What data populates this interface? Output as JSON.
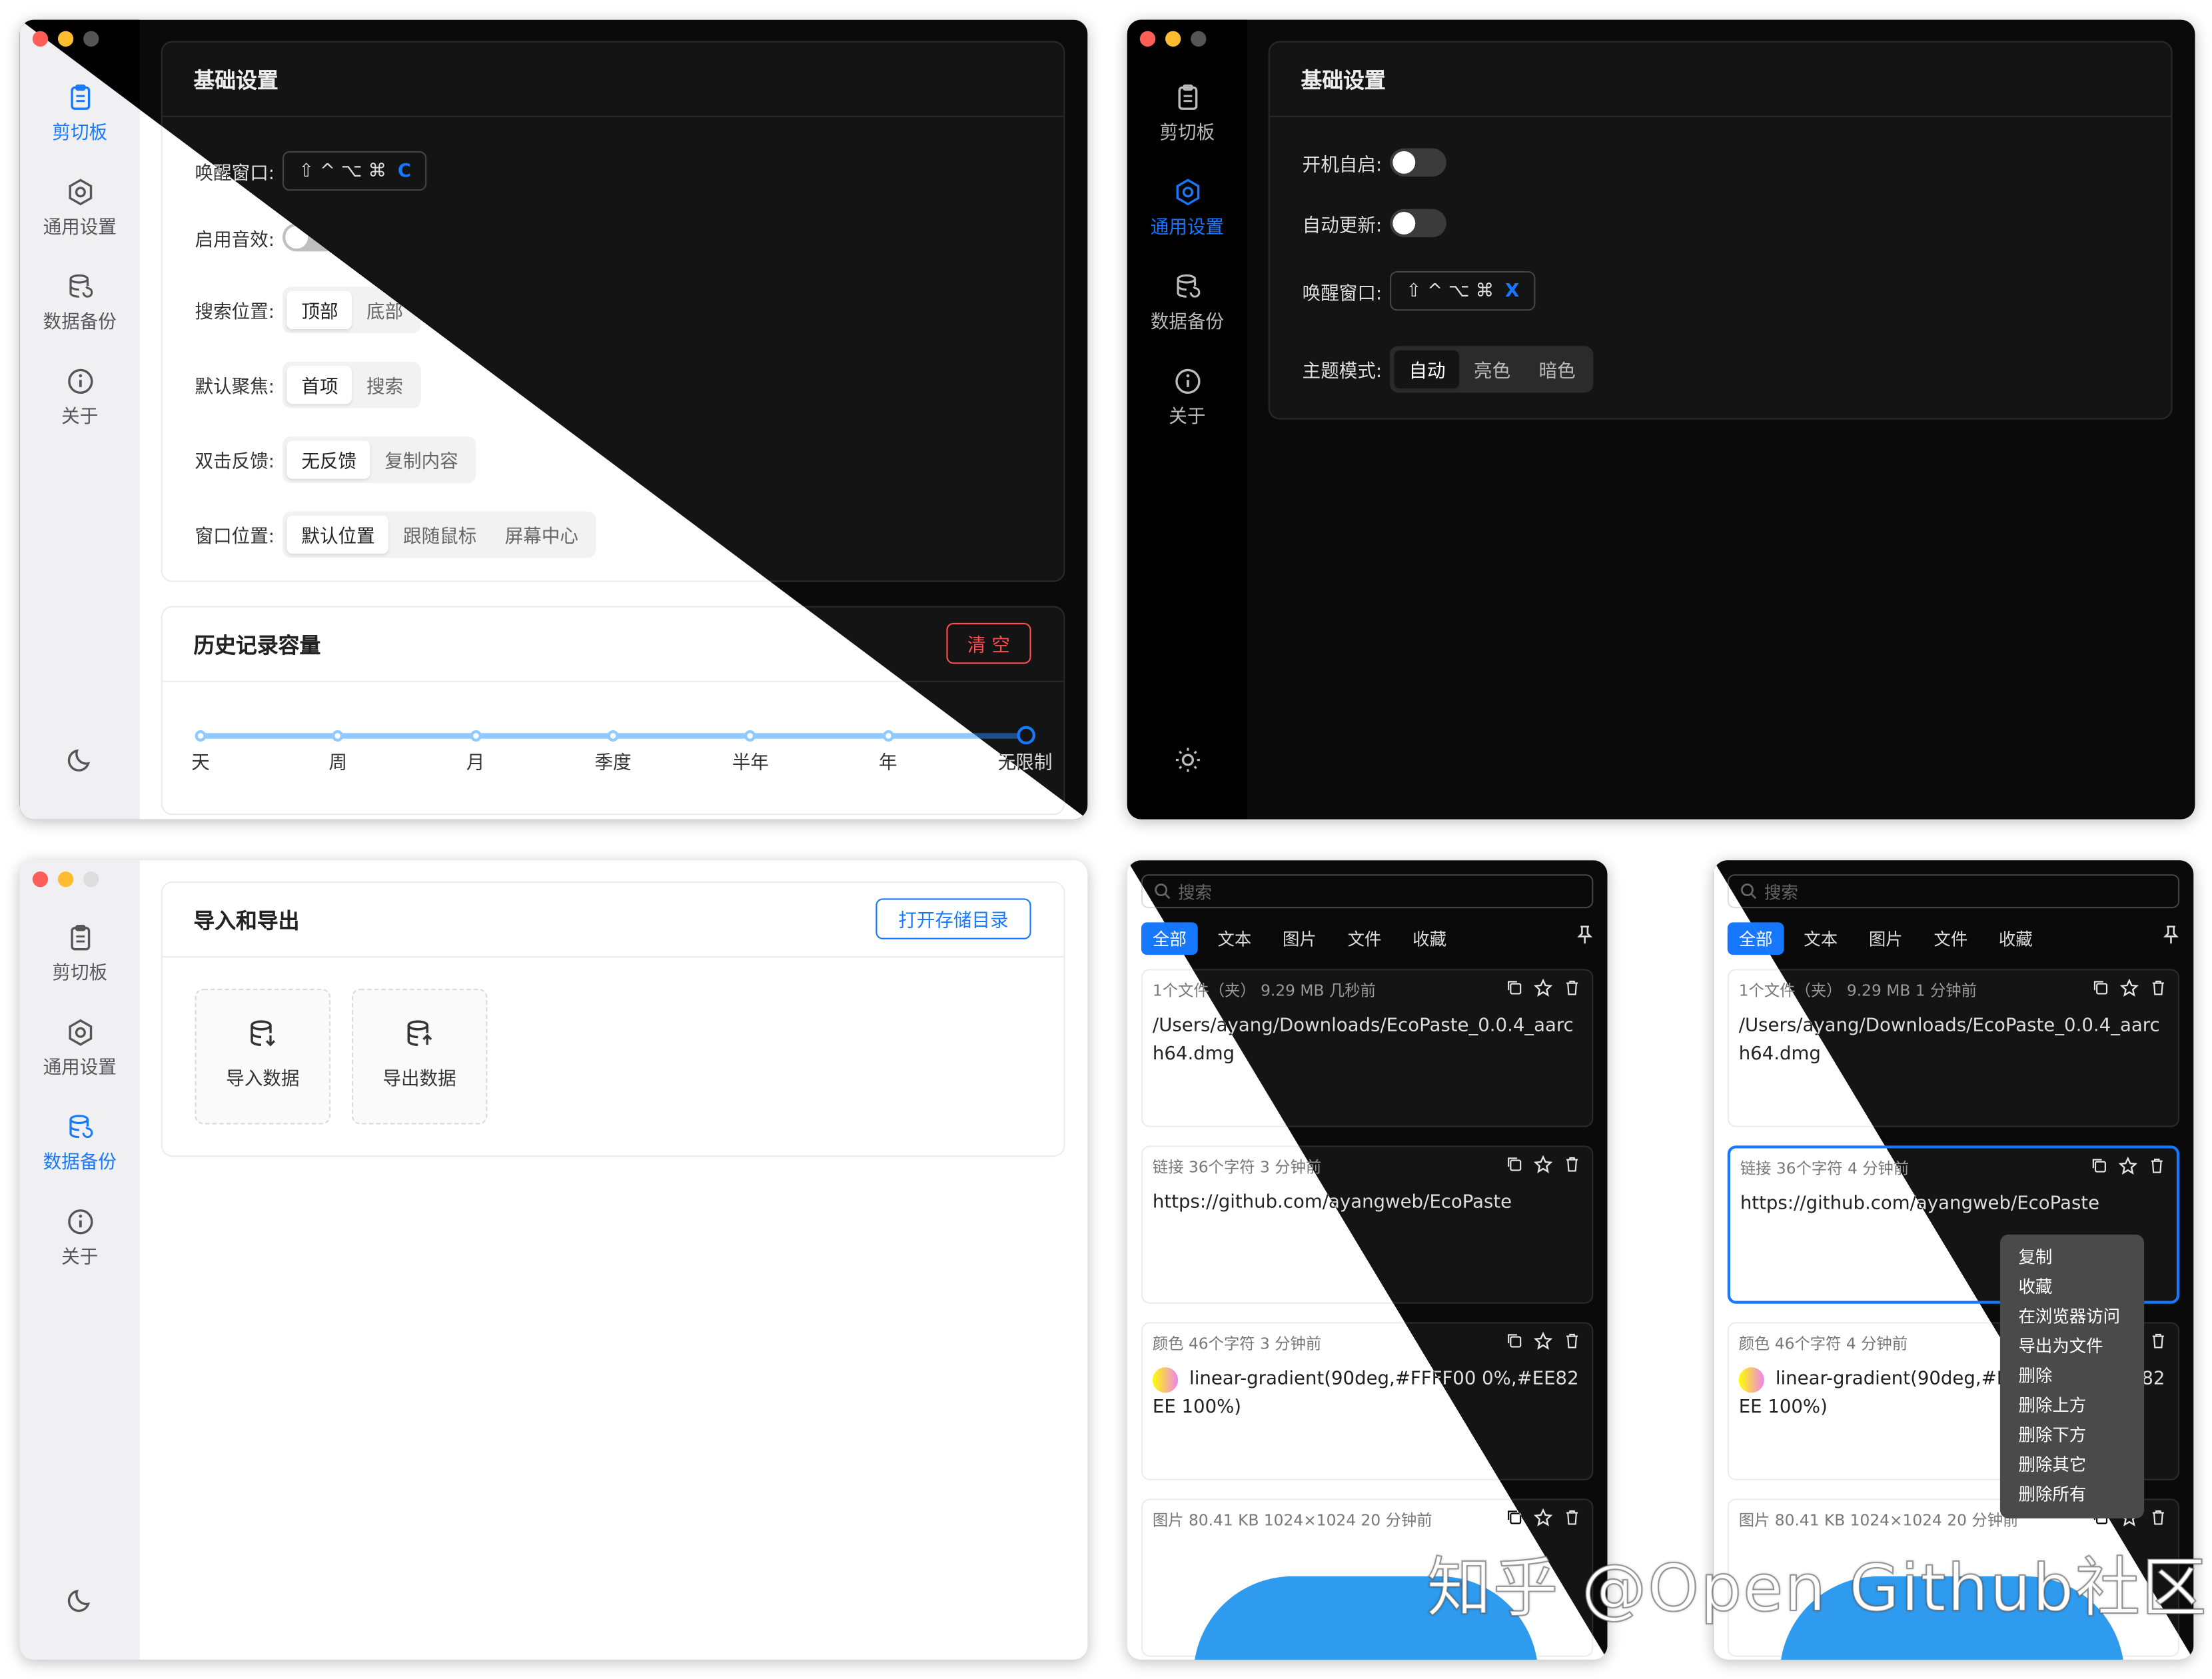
{
  "window_controls": {
    "close": "#ff5f57",
    "minimize": "#febc2e",
    "zoom": "#28c840",
    "inactive": "#555555"
  },
  "accent": "#1677ff",
  "sidebar": {
    "items": [
      {
        "label": "剪切板",
        "icon": "clipboard-icon"
      },
      {
        "label": "通用设置",
        "icon": "settings-icon"
      },
      {
        "label": "数据备份",
        "icon": "database-icon"
      },
      {
        "label": "关于",
        "icon": "info-icon"
      }
    ],
    "theme_icon_light": "moon-icon",
    "theme_icon_dark": "sun-icon"
  },
  "win1": {
    "basic_title": "基础设置",
    "wake_label": "唤醒窗口:",
    "wake_keys": "⇧ ^ ⌥ ⌘",
    "wake_key_last": "C",
    "sound_label": "启用音效:",
    "search_pos_label": "搜索位置:",
    "search_pos_options": [
      "顶部",
      "底部"
    ],
    "focus_label": "默认聚焦:",
    "focus_options": [
      "首项",
      "搜索"
    ],
    "dblclick_label": "双击反馈:",
    "dblclick_options": [
      "无反馈",
      "复制内容"
    ],
    "winpos_label": "窗口位置:",
    "winpos_options": [
      "默认位置",
      "跟随鼠标",
      "屏幕中心"
    ],
    "history_title": "历史记录容量",
    "clear_label": "清 空",
    "slider_marks": [
      "天",
      "周",
      "月",
      "季度",
      "半年",
      "年",
      "无限制"
    ],
    "slider_value": "无限制"
  },
  "win2": {
    "basic_title": "基础设置",
    "autostart_label": "开机自启:",
    "autoupdate_label": "自动更新:",
    "wake_label": "唤醒窗口:",
    "wake_keys": "⇧ ^ ⌥ ⌘",
    "wake_key_last": "X",
    "theme_label": "主题模式:",
    "theme_options": [
      "自动",
      "亮色",
      "暗色"
    ]
  },
  "win3": {
    "title": "导入和导出",
    "open_dir": "打开存储目录",
    "import_label": "导入数据",
    "export_label": "导出数据"
  },
  "popup": {
    "search_placeholder": "搜索",
    "tabs": [
      "全部",
      "文本",
      "图片",
      "文件",
      "收藏"
    ],
    "items_a": [
      {
        "meta": "1个文件（夹）  9.29 MB  几秒前",
        "body": "/Users/ayang/Downloads/EcoPaste_0.0.4_aarch64.dmg"
      },
      {
        "meta": "链接  36个字符  3 分钟前",
        "body": "https://github.com/ayangweb/EcoPaste"
      },
      {
        "meta": "颜色  46个字符  3 分钟前",
        "body": "linear-gradient(90deg,#FFFF00 0%,#EE82EE 100%)"
      },
      {
        "meta": "图片  80.41 KB  1024×1024  20 分钟前",
        "body": ""
      }
    ],
    "items_b": [
      {
        "meta": "1个文件（夹）  9.29 MB  1 分钟前",
        "body": "/Users/ayang/Downloads/EcoPaste_0.0.4_aarch64.dmg"
      },
      {
        "meta": "链接  36个字符  4 分钟前",
        "body": "https://github.com/ayangweb/EcoPaste"
      },
      {
        "meta": "颜色  46个字符  4 分钟前",
        "body": "linear-gradient(90deg,#FFFF00 0%,#EE82EE 100%)"
      },
      {
        "meta": "图片  80.41 KB  1024×1024  20 分钟前",
        "body": ""
      }
    ],
    "context_menu": [
      "复制",
      "收藏",
      "在浏览器访问",
      "导出为文件",
      "删除",
      "删除上方",
      "删除下方",
      "删除其它",
      "删除所有"
    ]
  },
  "watermark": "知乎 @Open Github社区"
}
